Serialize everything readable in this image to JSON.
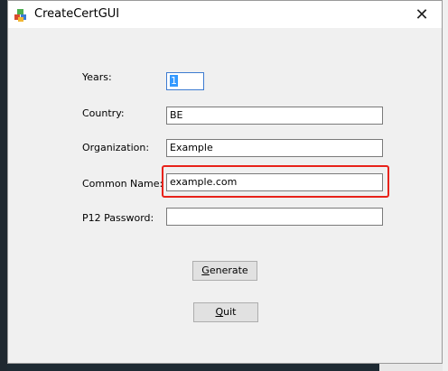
{
  "window": {
    "title": "CreateCertGUI",
    "close_glyph": "✕"
  },
  "form": {
    "years": {
      "label": "Years:",
      "value": "1"
    },
    "country": {
      "label": "Country:",
      "value": "BE"
    },
    "organization": {
      "label": "Organization:",
      "value": "Example"
    },
    "common_name": {
      "label": "Common Name:",
      "value": "example.com"
    },
    "p12_password": {
      "label": "P12 Password:",
      "value": ""
    }
  },
  "buttons": {
    "generate": {
      "mnemonic": "G",
      "rest": "enerate"
    },
    "quit": {
      "mnemonic": "Q",
      "rest": "uit"
    }
  },
  "colors": {
    "highlight": "#e8221a",
    "selection": "#3399ff"
  }
}
